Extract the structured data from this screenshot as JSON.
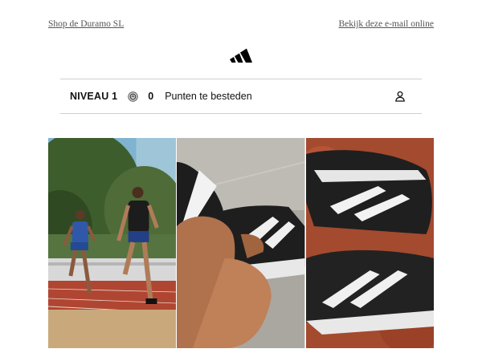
{
  "header": {
    "shop_link": "Shop de Duramo SL",
    "view_online_link": "Bekijk deze e-mail online"
  },
  "brand": {
    "logo_icon": "adidas-logo-icon",
    "accent_color": "#000000"
  },
  "loyalty": {
    "level_label": "NIVEAU 1",
    "coin_icon": "points-coin-icon",
    "points_value": "0",
    "points_label": "Punten te besteden",
    "account_icon": "user-account-icon"
  },
  "hero": {
    "panels": [
      {
        "name": "runners-on-track-photo"
      },
      {
        "name": "tying-shoe-photo"
      },
      {
        "name": "shoes-on-track-photo"
      }
    ]
  }
}
